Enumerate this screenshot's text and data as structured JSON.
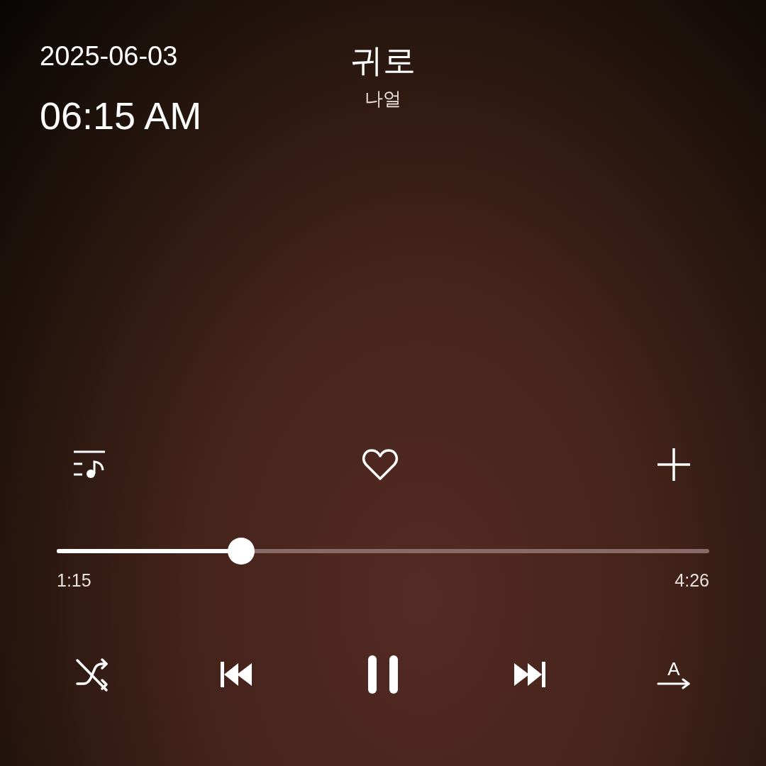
{
  "clock": {
    "date": "2025-06-03",
    "time": "06:15 AM"
  },
  "track": {
    "title": "귀로",
    "artist": "나얼"
  },
  "actions": [
    {
      "kind": "playlist"
    },
    {
      "kind": "like",
      "selected": false
    },
    {
      "kind": "add"
    }
  ],
  "progress": {
    "level": 0.283,
    "elapsed": "1:15",
    "total": "4:26"
  },
  "controls": [
    {
      "kind": "shuffle",
      "selected": false
    },
    {
      "kind": "previous"
    },
    {
      "kind": "pause"
    },
    {
      "kind": "next"
    },
    {
      "kind": "lyrics",
      "label": "A"
    }
  ]
}
